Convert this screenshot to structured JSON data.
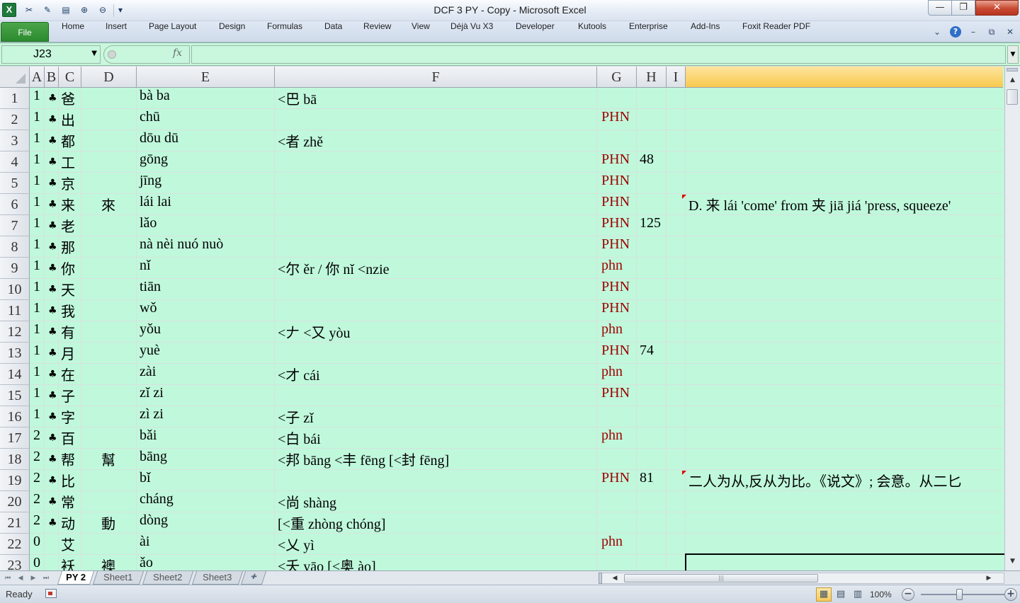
{
  "window": {
    "title": "DCF 3 PY - Copy - Microsoft Excel",
    "app_icon": "X",
    "qat_icons": [
      "cut-icon",
      "clear-icon",
      "copy-format-icon",
      "zoom-in-icon",
      "zoom-out-icon",
      "customize-qat-icon"
    ],
    "controls": {
      "minimize": "—",
      "restore": "❐",
      "close": "✕"
    }
  },
  "ribbon": {
    "file_tab": "File",
    "tabs": [
      "Home",
      "Insert",
      "Page Layout",
      "Design",
      "Formulas",
      "Data",
      "Review",
      "View",
      "Déjà Vu X3",
      "Developer",
      "Kutools",
      "Enterprise",
      "Add-Ins",
      "Foxit Reader PDF"
    ],
    "controls": {
      "collapse": "⌄",
      "help": "?",
      "minimize": "–",
      "restore": "⧉",
      "close": "✕"
    }
  },
  "formula_bar": {
    "name_box": "J23",
    "fx": "fx",
    "formula": ""
  },
  "columns": [
    "A",
    "B",
    "C",
    "D",
    "E",
    "F",
    "G",
    "H",
    "I",
    ""
  ],
  "selected_column_index": 9,
  "rows": [
    {
      "n": "1",
      "a": "1",
      "b": "♣",
      "c": "爸",
      "d": "",
      "e": "bà ba",
      "f": "<巴 bā",
      "g": "",
      "h": "",
      "j": "",
      "comment": false
    },
    {
      "n": "2",
      "a": "1",
      "b": "♣",
      "c": "出",
      "d": "",
      "e": "chū",
      "f": "",
      "g": "PHN",
      "h": "",
      "j": "",
      "comment": false
    },
    {
      "n": "3",
      "a": "1",
      "b": "♣",
      "c": "都",
      "d": "",
      "e": "dōu dū",
      "f": "<者 zhě",
      "g": "",
      "h": "",
      "j": "",
      "comment": false
    },
    {
      "n": "4",
      "a": "1",
      "b": "♣",
      "c": "工",
      "d": "",
      "e": "gōng",
      "f": "",
      "g": "PHN",
      "h": "48",
      "j": "",
      "comment": false
    },
    {
      "n": "5",
      "a": "1",
      "b": "♣",
      "c": "京",
      "d": "",
      "e": "jīng",
      "f": "",
      "g": "PHN",
      "h": "",
      "j": "",
      "comment": false
    },
    {
      "n": "6",
      "a": "1",
      "b": "♣",
      "c": "来",
      "d": "來",
      "e": "lái lai",
      "f": "",
      "g": "PHN",
      "h": "",
      "j": "D. 来 lái 'come' from 夹 jiā jiá 'press, squeeze'",
      "comment": true
    },
    {
      "n": "7",
      "a": "1",
      "b": "♣",
      "c": "老",
      "d": "",
      "e": "lǎo",
      "f": "",
      "g": "PHN",
      "h": "125",
      "j": "",
      "comment": false
    },
    {
      "n": "8",
      "a": "1",
      "b": "♣",
      "c": "那",
      "d": "",
      "e": "nà nèi nuó nuò",
      "f": "",
      "g": "PHN",
      "h": "",
      "j": "",
      "comment": false
    },
    {
      "n": "9",
      "a": "1",
      "b": "♣",
      "c": "你",
      "d": "",
      "e": "nǐ",
      "f": "<尔 ěr / 你 nǐ <nzie",
      "g": "phn",
      "h": "",
      "j": "",
      "comment": false
    },
    {
      "n": "10",
      "a": "1",
      "b": "♣",
      "c": "天",
      "d": "",
      "e": "tiān",
      "f": "",
      "g": "PHN",
      "h": "",
      "j": "",
      "comment": false
    },
    {
      "n": "11",
      "a": "1",
      "b": "♣",
      "c": "我",
      "d": "",
      "e": "wǒ",
      "f": "",
      "g": "PHN",
      "h": "",
      "j": "",
      "comment": false
    },
    {
      "n": "12",
      "a": "1",
      "b": "♣",
      "c": "有",
      "d": "",
      "e": "yǒu",
      "f": "<𠂇 <又 yòu",
      "g": "phn",
      "h": "",
      "j": "",
      "comment": false
    },
    {
      "n": "13",
      "a": "1",
      "b": "♣",
      "c": "月",
      "d": "",
      "e": "yuè",
      "f": "",
      "g": "PHN",
      "h": "74",
      "j": "",
      "comment": false
    },
    {
      "n": "14",
      "a": "1",
      "b": "♣",
      "c": "在",
      "d": "",
      "e": "zài",
      "f": "<才 cái",
      "g": "phn",
      "h": "",
      "j": "",
      "comment": false
    },
    {
      "n": "15",
      "a": "1",
      "b": "♣",
      "c": "子",
      "d": "",
      "e": "zǐ zi",
      "f": "",
      "g": "PHN",
      "h": "",
      "j": "",
      "comment": false
    },
    {
      "n": "16",
      "a": "1",
      "b": "♣",
      "c": "字",
      "d": "",
      "e": "zì zi",
      "f": "<子 zǐ",
      "g": "",
      "h": "",
      "j": "",
      "comment": false
    },
    {
      "n": "17",
      "a": "2",
      "b": "♣",
      "c": "百",
      "d": "",
      "e": "bǎi",
      "f": "<白 bái",
      "g": "phn",
      "h": "",
      "j": "",
      "comment": false
    },
    {
      "n": "18",
      "a": "2",
      "b": "♣",
      "c": "帮",
      "d": "幫",
      "e": "bāng",
      "f": "<邦 bāng <丰 fēng [<封 fēng]",
      "g": "",
      "h": "",
      "j": "",
      "comment": false
    },
    {
      "n": "19",
      "a": "2",
      "b": "♣",
      "c": "比",
      "d": "",
      "e": "bǐ",
      "f": "",
      "g": "PHN",
      "h": "81",
      "j": "二人为从,反从为比。《说文》; 会意。从二匕",
      "comment": true
    },
    {
      "n": "20",
      "a": "2",
      "b": "♣",
      "c": "常",
      "d": "",
      "e": "cháng",
      "f": "<尚 shàng",
      "g": "",
      "h": "",
      "j": "",
      "comment": false
    },
    {
      "n": "21",
      "a": "2",
      "b": "♣",
      "c": "动",
      "d": "動",
      "e": "dòng",
      "f": "[<重 zhòng chóng]",
      "g": "",
      "h": "",
      "j": "",
      "comment": false
    },
    {
      "n": "22",
      "a": "0",
      "b": "",
      "c": "艾",
      "d": "",
      "e": "ài",
      "f": "<乂 yì",
      "g": "phn",
      "h": "",
      "j": "",
      "comment": false
    },
    {
      "n": "23",
      "a": "0",
      "b": "",
      "c": "袄",
      "d": "襖",
      "e": "ǎo",
      "f": "<夭 yāo [<奥 ào]",
      "g": "",
      "h": "",
      "j": "",
      "comment": false
    }
  ],
  "sheets": {
    "nav": [
      "⏮",
      "◀",
      "▶",
      "⏭"
    ],
    "tabs": [
      "PY 2",
      "Sheet1",
      "Sheet2",
      "Sheet3"
    ],
    "active_index": 0,
    "new_sheet_icon": "insert-sheet-icon"
  },
  "scrollbar": {
    "thumb_grip": "|||",
    "up": "▲",
    "down": "▼",
    "left": "◀",
    "right": "▶"
  },
  "status": {
    "ready": "Ready",
    "views": [
      "normal-view-icon",
      "page-layout-view-icon",
      "page-break-preview-icon"
    ],
    "view_glyphs": [
      "▦",
      "▤",
      "▥"
    ],
    "zoom": "100%",
    "zoom_out": "−",
    "zoom_in": "+"
  },
  "colors": {
    "cell_bg": "#c0f8dc",
    "phn_red": "#a00000",
    "selected_header": "#f8c94e",
    "file_tab": "#2b8a2e"
  }
}
